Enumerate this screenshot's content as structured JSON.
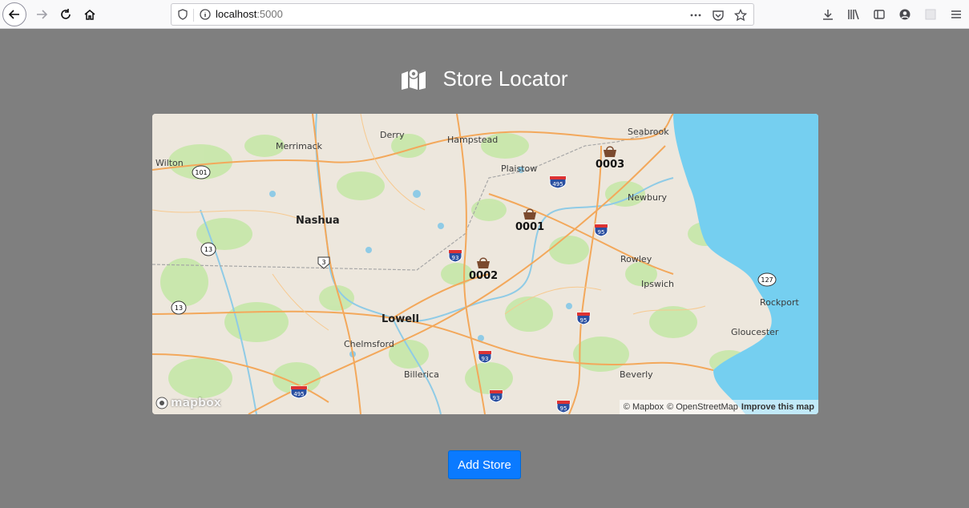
{
  "browser": {
    "url_host": "localhost",
    "url_port": ":5000"
  },
  "page": {
    "title": "Store Locator",
    "add_store_label": "Add Store"
  },
  "map": {
    "places": [
      {
        "name": "Derry",
        "big": false
      },
      {
        "name": "Hampstead",
        "big": false
      },
      {
        "name": "Seabrook",
        "big": false
      },
      {
        "name": "Merrimack",
        "big": false
      },
      {
        "name": "Wilton",
        "big": false
      },
      {
        "name": "Plaistow",
        "big": false
      },
      {
        "name": "Newbury",
        "big": false
      },
      {
        "name": "Nashua",
        "big": true
      },
      {
        "name": "Rowley",
        "big": false
      },
      {
        "name": "Ipswich",
        "big": false
      },
      {
        "name": "Rockport",
        "big": false
      },
      {
        "name": "Gloucester",
        "big": false
      },
      {
        "name": "Lowell",
        "big": true
      },
      {
        "name": "Chelmsford",
        "big": false
      },
      {
        "name": "Billerica",
        "big": false
      },
      {
        "name": "Beverly",
        "big": false
      }
    ],
    "stores": [
      {
        "id": "0001"
      },
      {
        "id": "0002"
      },
      {
        "id": "0003"
      }
    ],
    "shields": [
      "101",
      "13",
      "3",
      "13",
      "93",
      "495",
      "95",
      "95",
      "93",
      "93",
      "495",
      "95",
      "127"
    ],
    "attribution": {
      "mapbox": "© Mapbox",
      "osm": "© OpenStreetMap",
      "improve": "Improve this map"
    },
    "logo": "mapbox",
    "colors": {
      "water": "#75cff0",
      "land": "#ede7dd",
      "park": "#c6e7a8",
      "road": "#f3a85b",
      "marker": "#7b4a2e"
    }
  }
}
